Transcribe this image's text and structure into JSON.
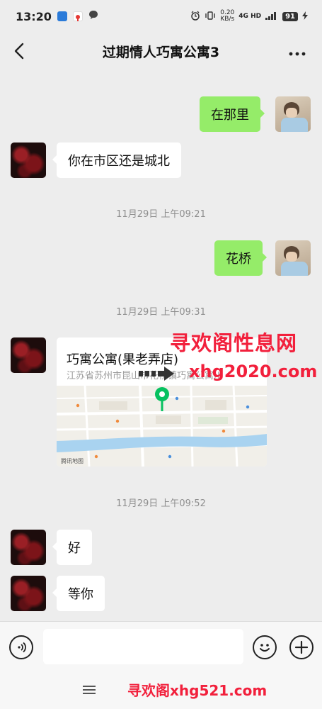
{
  "status_bar": {
    "time": "13:20",
    "notification_icons": [
      "app-icon-blue",
      "maps-pin-icon",
      "chat-bubble-icon"
    ],
    "net_speed_value": "0.20",
    "net_speed_unit": "KB/s",
    "network_label": "4G HD",
    "battery": "91"
  },
  "header": {
    "title": "过期情人巧寓公寓3",
    "back_icon": "chevron-left-icon",
    "more_icon": "more-dots-icon"
  },
  "messages": [
    {
      "sender": "self",
      "text": "在那里"
    },
    {
      "sender": "contact",
      "text": "你在市区还是城北"
    },
    {
      "type": "timestamp",
      "text": "11月29日 上午09:21"
    },
    {
      "sender": "self",
      "text": "花桥"
    },
    {
      "type": "timestamp",
      "text": "11月29日 上午09:31"
    },
    {
      "sender": "contact",
      "type": "location",
      "name": "巧寓公寓(果老弄店)",
      "address": "江苏省苏州市昆山市花桥镇巧寓公寓川"
    },
    {
      "type": "timestamp",
      "text": "11月29日 上午09:52"
    },
    {
      "sender": "contact",
      "text": "好"
    },
    {
      "sender": "contact",
      "text": "等你"
    }
  ],
  "map": {
    "credit": "腾讯地图",
    "pin_color": "#07c160"
  },
  "watermarks": {
    "title": "寻欢阁性息网",
    "url": "xhg2020.com",
    "bottom": "寻欢阁xhg521.com"
  },
  "input_bar": {
    "placeholder": "",
    "voice_icon": "voice-icon",
    "emoji_icon": "emoji-icon",
    "add_icon": "plus-icon"
  },
  "colors": {
    "background": "#ededed",
    "bubble_out": "#95ec69",
    "bubble_in": "#ffffff",
    "watermark": "#f2203c"
  }
}
